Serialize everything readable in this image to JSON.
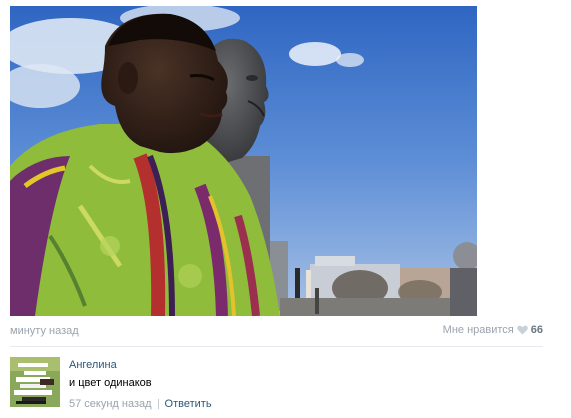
{
  "post": {
    "photo": {
      "description_icon": "photo-image"
    },
    "time_ago": "минуту назад",
    "like": {
      "label": "Мне нравится",
      "count": "66",
      "icon": "heart-icon"
    }
  },
  "comment": {
    "author": "Ангелина",
    "text": "и цвет одинаков",
    "time_ago": "57 секунд назад",
    "reply_label": "Ответить",
    "avatar_icon": "avatar"
  },
  "colors": {
    "link": "#2b587a",
    "muted": "#9aa3ad",
    "divider": "#e7ebef"
  }
}
